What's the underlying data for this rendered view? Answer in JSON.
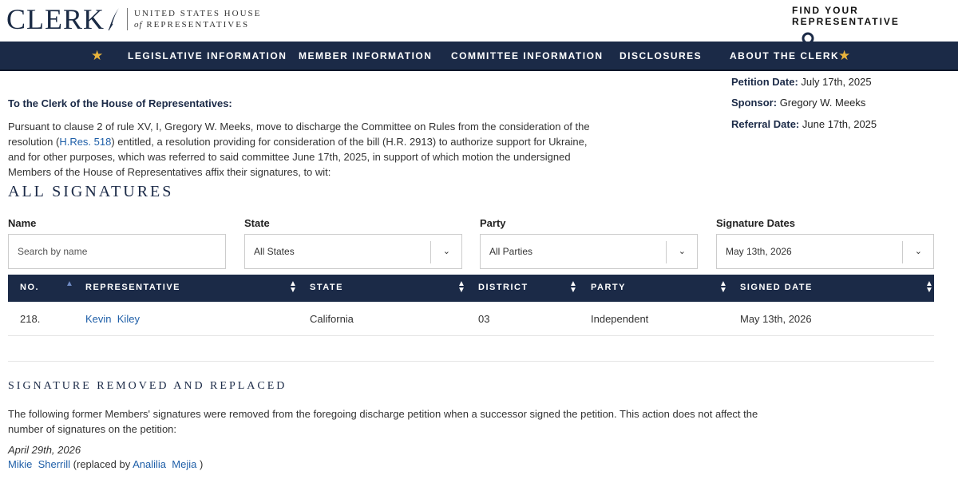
{
  "header": {
    "logo_main": "CLERK",
    "logo_sub_line1": "UNITED STATES HOUSE",
    "logo_sub_of": "of",
    "logo_sub_line2": "REPRESENTATIVES",
    "find_rep_label": "FIND YOUR REPRESENTATIVE"
  },
  "nav": {
    "items": [
      {
        "label": "LEGISLATIVE INFORMATION"
      },
      {
        "label": "MEMBER INFORMATION"
      },
      {
        "label": "COMMITTEE INFORMATION"
      },
      {
        "label": "DISCLOSURES"
      },
      {
        "label": "ABOUT THE CLERK"
      }
    ]
  },
  "meta": {
    "petition_date_label": "Petition Date:",
    "petition_date": "July 17th, 2025",
    "sponsor_label": "Sponsor:",
    "sponsor": "Gregory W. Meeks",
    "referral_date_label": "Referral Date:",
    "referral_date": "June 17th, 2025"
  },
  "intro": {
    "heading": "To the Clerk of the House of Representatives:",
    "text_1": "Pursuant to clause 2 of rule XV, I, Gregory W. Meeks, move to discharge the Committee on Rules from the consideration of the resolution (",
    "resolution_link": "H.Res. 518",
    "text_2": ") entitled, a resolution providing for consideration of the bill (H.R. 2913) to authorize support for Ukraine, and for other purposes, which was referred to said committee June 17th, 2025, in support of which motion the undersigned Members of the House of Representatives affix their signatures, to wit:"
  },
  "signatures": {
    "title": "ALL SIGNATURES",
    "filters": {
      "name_label": "Name",
      "name_placeholder": "Search by name",
      "state_label": "State",
      "state_value": "All States",
      "party_label": "Party",
      "party_value": "All Parties",
      "dates_label": "Signature Dates",
      "dates_value": "May 13th, 2026"
    },
    "columns": [
      "NO.",
      "REPRESENTATIVE",
      "STATE",
      "DISTRICT",
      "PARTY",
      "SIGNED DATE"
    ],
    "rows": [
      {
        "no": "218.",
        "first_name": "Kevin",
        "last_name": "Kiley",
        "state": "California",
        "district": "03",
        "party": "Independent",
        "signed_date": "May 13th, 2026"
      }
    ]
  },
  "removed": {
    "title": "SIGNATURE REMOVED AND REPLACED",
    "text": "The following former Members' signatures were removed from the foregoing discharge petition when a successor signed the petition. This action does not affect the number of signatures on the petition:",
    "date": "April 29th, 2026",
    "removed_first": "Mikie",
    "removed_last": "Sherrill",
    "replaced_by_text": "(replaced by",
    "successor_first": "Analilia",
    "successor_last": "Mejia",
    "close_paren": ")"
  },
  "colors": {
    "navy": "#1b2a47",
    "gold_star": "#e8b33c",
    "link_blue": "#1f5fa8"
  },
  "icons": [
    "feather-icon",
    "search-icon",
    "star-icon",
    "chevron-down-icon",
    "sort-icon"
  ]
}
